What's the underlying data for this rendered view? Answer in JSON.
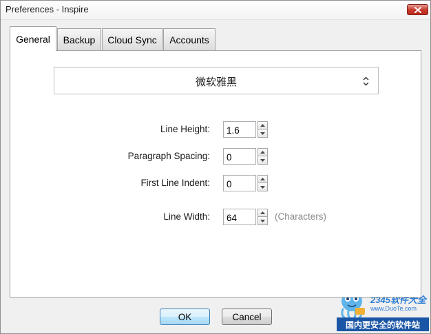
{
  "window": {
    "title": "Preferences - Inspire"
  },
  "tabs": [
    {
      "label": "General",
      "active": true
    },
    {
      "label": "Backup",
      "active": false
    },
    {
      "label": "Cloud Sync",
      "active": false
    },
    {
      "label": "Accounts",
      "active": false
    }
  ],
  "general": {
    "font_select": {
      "value": "微软雅黑"
    },
    "fields": [
      {
        "label": "Line Height:",
        "value": "1.6"
      },
      {
        "label": "Paragraph Spacing:",
        "value": "0"
      },
      {
        "label": "First Line Indent:",
        "value": "0"
      },
      {
        "label": "Line Width:",
        "value": "64",
        "units": "(Characters)"
      }
    ]
  },
  "buttons": {
    "ok_label": "OK",
    "cancel_label": "Cancel"
  },
  "watermark": {
    "brand": "2345软件大全",
    "url": "www.DuoTe.com",
    "slogan": "国内更安全的软件站"
  },
  "colors": {
    "accent_button": "#bee6fd",
    "close_button": "#c7372a",
    "watermark_blue": "#1b56a6"
  }
}
